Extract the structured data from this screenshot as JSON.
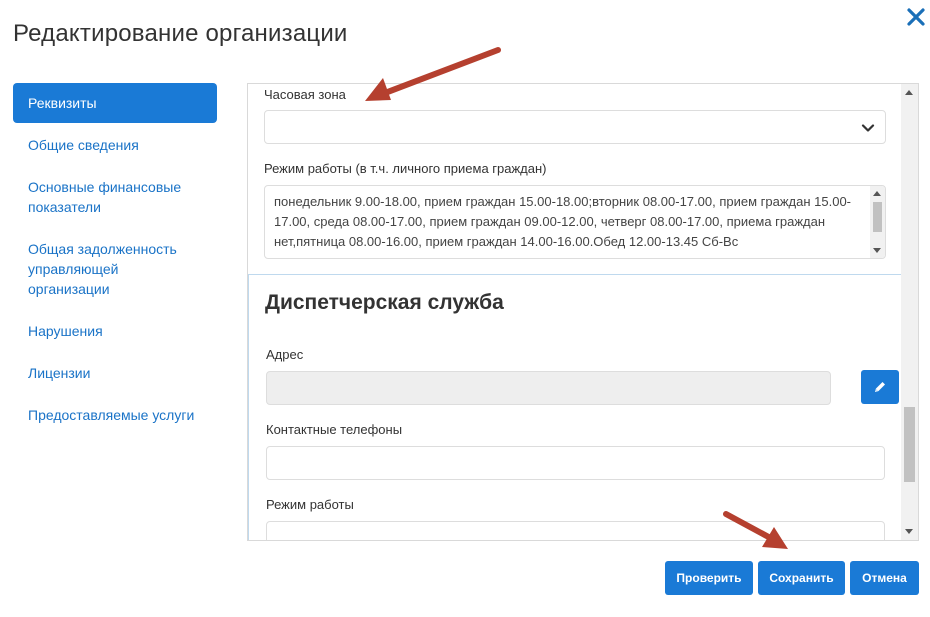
{
  "modal": {
    "title": "Редактирование организации"
  },
  "sidebar": {
    "items": [
      {
        "label": "Реквизиты",
        "active": true
      },
      {
        "label": "Общие сведения"
      },
      {
        "label": "Основные финансовые показатели"
      },
      {
        "label": "Общая задолженность управляющей организации"
      },
      {
        "label": "Нарушения"
      },
      {
        "label": "Лицензии"
      },
      {
        "label": "Предоставляемые услуги"
      }
    ]
  },
  "form": {
    "timezone": {
      "label": "Часовая зона",
      "value": ""
    },
    "work_hours": {
      "label": "Режим работы (в т.ч. личного приема граждан)",
      "value": "понедельник 9.00-18.00, прием граждан 15.00-18.00;вторник 08.00-17.00, прием граждан 15.00-17.00, среда 08.00-17.00, прием граждан 09.00-12.00, четверг 08.00-17.00, приема граждан нет,пятница 08.00-16.00, прием граждан 14.00-16.00.Обед 12.00-13.45 Сб-Вс"
    },
    "dispatch": {
      "title": "Диспетчерская служба",
      "address_label": "Адрес",
      "address_value": "",
      "phones_label": "Контактные телефоны",
      "phones_value": "",
      "hours_label": "Режим работы",
      "hours_value": ""
    }
  },
  "buttons": {
    "check": "Проверить",
    "save": "Сохранить",
    "cancel": "Отмена"
  },
  "icons": {
    "close": "close-icon",
    "chevron": "chevron-down-icon",
    "edit": "pencil-icon"
  },
  "colors": {
    "primary": "#1a7ad6",
    "link": "#1a73c7",
    "annotation_arrow": "#b5402f",
    "close": "#1a6fb8"
  }
}
